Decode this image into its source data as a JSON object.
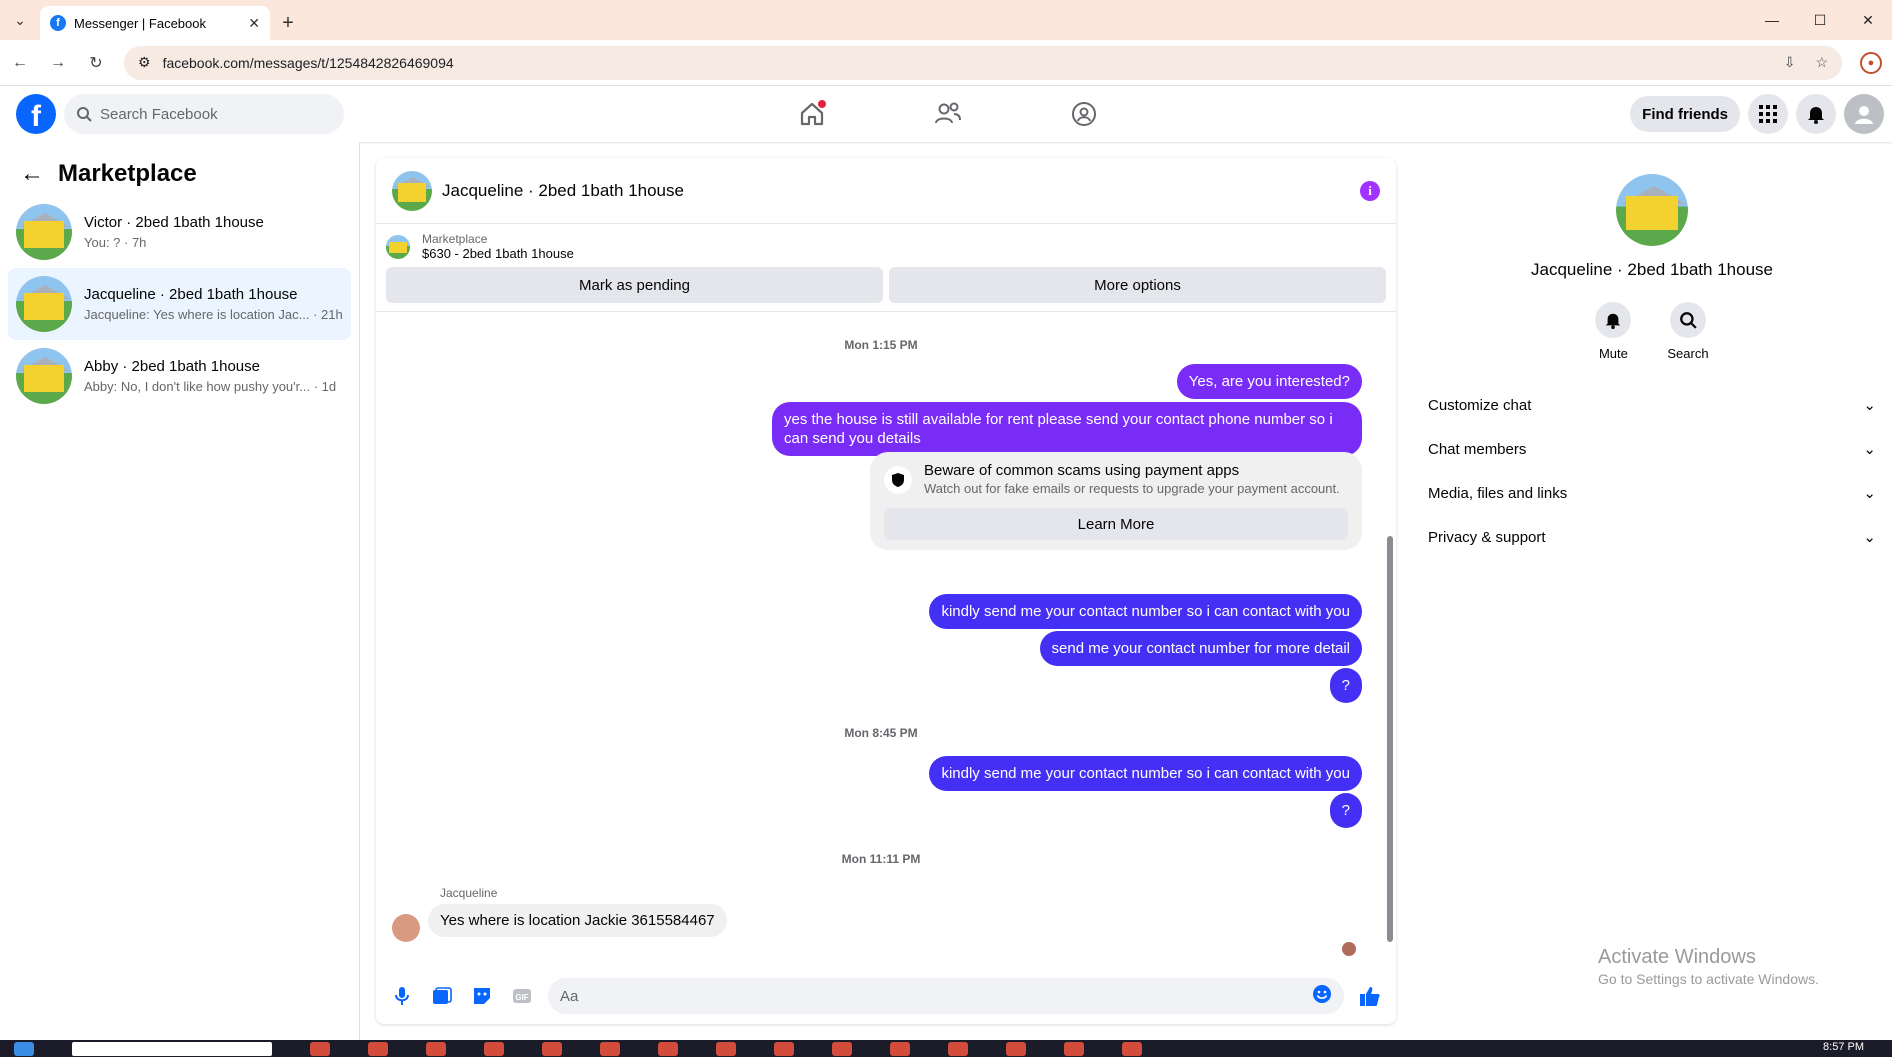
{
  "browser": {
    "tab_title": "Messenger | Facebook",
    "url": "facebook.com/messages/t/1254842826469094"
  },
  "header": {
    "search_placeholder": "Search Facebook",
    "find_friends": "Find friends"
  },
  "left": {
    "title": "Marketplace",
    "conversations": [
      {
        "name": "Victor · 2bed 1bath 1house",
        "preview": "You: ? · 7h"
      },
      {
        "name": "Jacqueline · 2bed 1bath 1house",
        "preview": "Jacqueline: Yes where is location Jac... · 21h"
      },
      {
        "name": "Abby · 2bed 1bath 1house",
        "preview": "Abby: No, I don't like how pushy you'r... · 1d"
      }
    ]
  },
  "chat": {
    "title": "Jacqueline · 2bed 1bath 1house",
    "marketplace_label": "Marketplace",
    "listing": "$630 - 2bed 1bath 1house",
    "mark_pending": "Mark as pending",
    "more_options": "More options",
    "ts1": "Mon 1:15 PM",
    "m1": "Yes, are you interested?",
    "m2": "yes the house is still available for rent please send your contact phone number so i can send you details",
    "scam_title": "Beware of common scams using payment apps",
    "scam_desc": "Watch out for fake emails or requests to upgrade your payment account.",
    "learn_more": "Learn More",
    "m3": "kindly send me your contact number so i can contact with you",
    "m4": "send me your contact number for more detail",
    "m5": "?",
    "ts2": "Mon 8:45 PM",
    "m6": "kindly send me your contact number so i can contact with you",
    "m7": "?",
    "ts3": "Mon 11:11 PM",
    "sender": "Jacqueline",
    "m8": "Yes where is location Jackie 3615584467",
    "input_placeholder": "Aa"
  },
  "right": {
    "name": "Jacqueline · 2bed 1bath 1house",
    "mute": "Mute",
    "search": "Search",
    "sections": [
      "Customize chat",
      "Chat members",
      "Media, files and links",
      "Privacy & support"
    ]
  },
  "watermark": {
    "line1": "Activate Windows",
    "line2": "Go to Settings to activate Windows."
  },
  "taskbar": {
    "time": "8:57 PM"
  },
  "colors": {
    "accent": "#0866ff",
    "outgoing_purple": "#7a2cf7",
    "outgoing_blue": "#4430f5",
    "info": "#a033ff"
  }
}
